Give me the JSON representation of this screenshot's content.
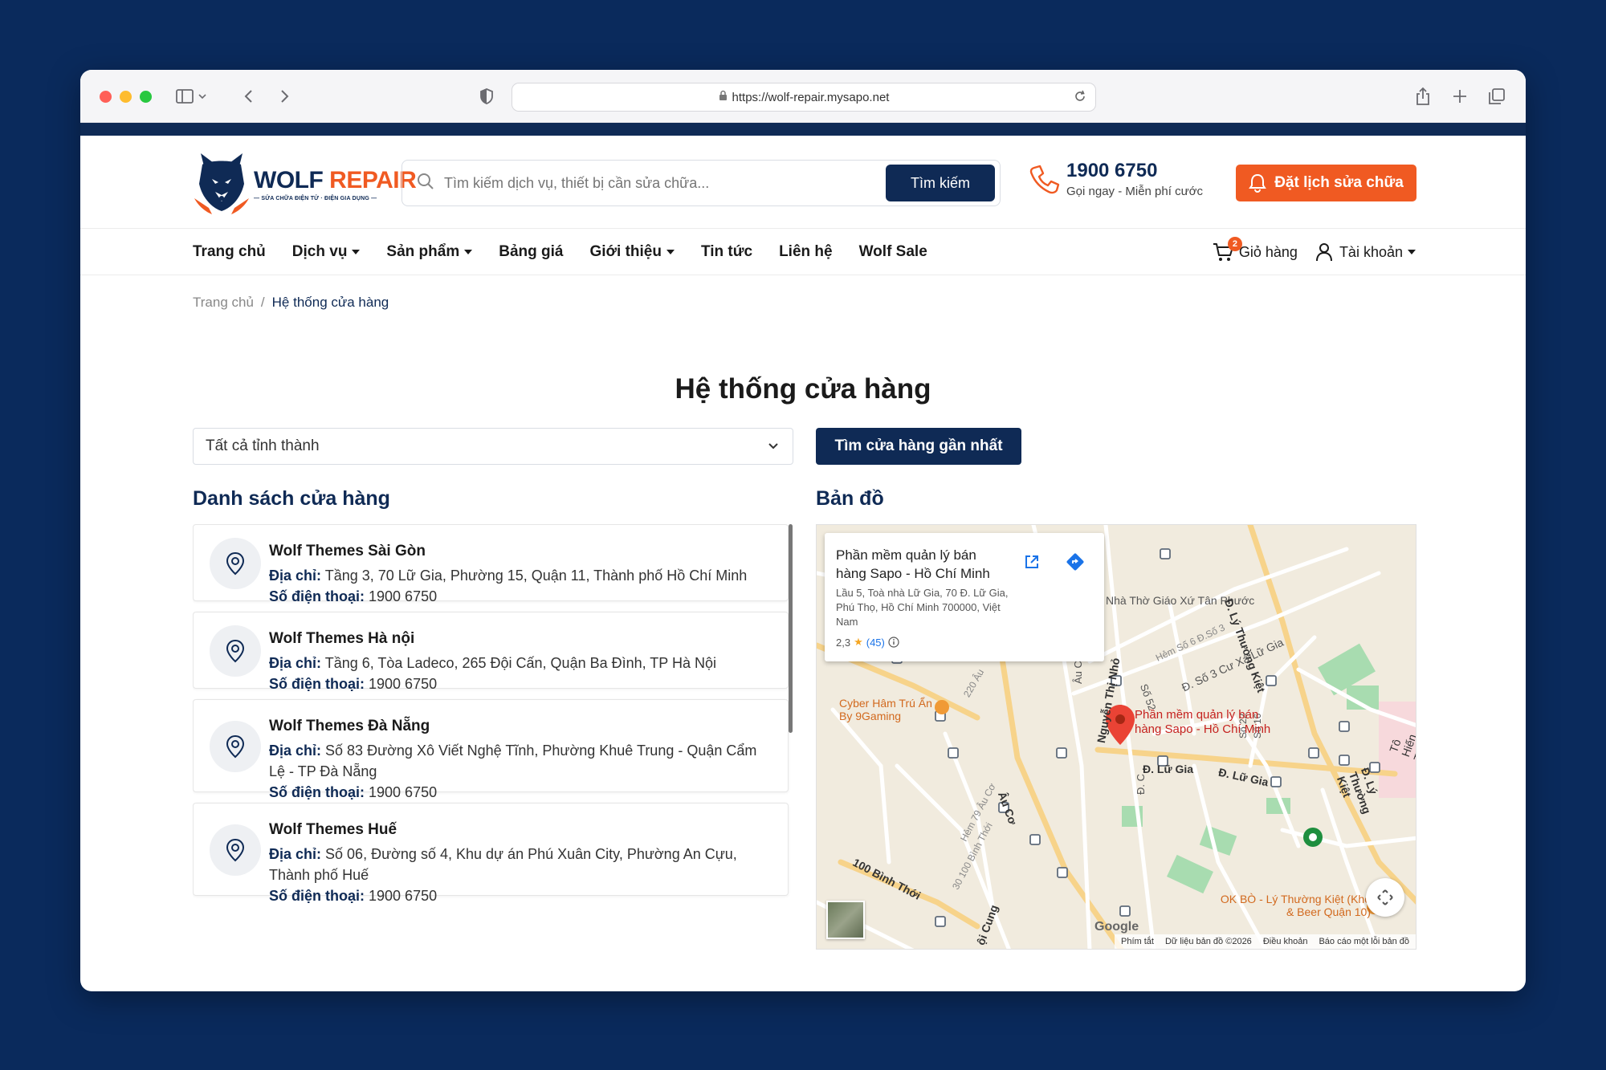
{
  "browser": {
    "url": "https://wolf-repair.mysapo.net"
  },
  "header": {
    "logo_title_a": "WOLF",
    "logo_title_b": "REPAIR",
    "logo_sub": "— SỬA CHỮA ĐIỆN TỬ · ĐIỆN GIA DỤNG —",
    "search_placeholder": "Tìm kiếm dịch vụ, thiết bị cần sửa chữa...",
    "search_button": "Tìm kiếm",
    "hotline_number": "1900 6750",
    "hotline_sub": "Gọi ngay - Miễn phí cước",
    "book_button": "Đặt lịch sửa chữa"
  },
  "nav": {
    "items": [
      {
        "label": "Trang chủ",
        "dropdown": false
      },
      {
        "label": "Dịch vụ",
        "dropdown": true
      },
      {
        "label": "Sản phẩm",
        "dropdown": true
      },
      {
        "label": "Bảng giá",
        "dropdown": false
      },
      {
        "label": "Giới thiệu",
        "dropdown": true
      },
      {
        "label": "Tin tức",
        "dropdown": false
      },
      {
        "label": "Liên hệ",
        "dropdown": false
      },
      {
        "label": "Wolf Sale",
        "dropdown": false
      }
    ],
    "cart_count": "2",
    "cart_label": "Giỏ hàng",
    "account_label": "Tài khoản"
  },
  "breadcrumb": {
    "home": "Trang chủ",
    "separator": "/",
    "current": "Hệ thống cửa hàng"
  },
  "page": {
    "title": "Hệ thống cửa hàng",
    "province_select": "Tất cả tỉnh thành",
    "nearest_button": "Tìm cửa hàng gần nhất",
    "list_title": "Danh sách cửa hàng",
    "map_title": "Bản đồ"
  },
  "stores": [
    {
      "name": "Wolf Themes Sài Gòn",
      "address_label": "Địa chỉ:",
      "address": "Tầng 3, 70 Lữ Gia, Phường 15, Quận 11, Thành phố Hồ Chí Minh",
      "phone_label": "Số điện thoại:",
      "phone": "1900 6750"
    },
    {
      "name": "Wolf Themes Hà nội",
      "address_label": "Địa chỉ:",
      "address": "Tầng 6, Tòa Ladeco, 265 Đội Cấn, Quận Ba Đình, TP Hà Nội",
      "phone_label": "Số điện thoại:",
      "phone": "1900 6750"
    },
    {
      "name": "Wolf Themes Đà Nẵng",
      "address_label": "Địa chỉ:",
      "address": "Số 83 Đường Xô Viết Nghệ Tĩnh, Phường Khuê Trung - Quận Cẩm Lệ - TP Đà Nẵng",
      "phone_label": "Số điện thoại:",
      "phone": "1900 6750"
    },
    {
      "name": "Wolf Themes Huế",
      "address_label": "Địa chỉ:",
      "address": "Số 06, Đường số 4, Khu dự án Phú Xuân City, Phường An Cựu, Thành phố Huế",
      "phone_label": "Số điện thoại:",
      "phone": "1900 6750"
    }
  ],
  "map": {
    "info_title": "Phần mềm quản lý bán hàng Sapo - Hồ Chí Minh",
    "info_address": "Lầu 5, Toà nhà Lữ Gia, 70 Đ. Lữ Gia, Phú Thọ, Hồ Chí Minh 700000, Việt Nam",
    "info_rating": "2,3",
    "info_reviews": "(45)",
    "pin_label": "Phần mềm quản lý bán hàng Sapo - Hồ Chí Minh",
    "labels": {
      "church": "Nhà Thờ Giáo Xứ Tân Phước",
      "cyber": "Cyber Hâm Trú Ẩn By 9Gaming",
      "okbo": "OK BÒ - Lý Thường Kiệt (Kho & Beer Quận 10)",
      "ly_thuong_kiet": "Đ. Lý Thường Kiệt",
      "ly_thuong_kiet_2": "Đ. Lý Thường Kiệt",
      "lu_gia": "Đ. Lữ Gia",
      "lu_gia_2": "Đ. Lữ Gia",
      "au_co": "Âu Cơ",
      "binh_thoi": "100 Bình Thới",
      "to_hien_thanh": "Tô Hiến Th",
      "nguyen_thi_nho": "Nguyễn Thị Nhỏ",
      "cu_xa": "Đ. Số 3 Cư Xá Lữ Gia",
      "hem_so_6": "Hẻm Số 6 Đ.Số 3",
      "hem_220": "220 Âu",
      "hem_79": "Hẻm 79 Âu Cơ",
      "hem_30": "30 100 Bình Thới",
      "doi_cung": "ội Cung",
      "so_52": "Số 52",
      "so_22": "Số 22",
      "so_16": "Số 16",
      "au_co_2": "Âu Cơ",
      "d_c": "Đ. C",
      "google": "Google"
    },
    "footer": [
      "Phím tắt",
      "Dữ liệu bản đồ ©2026",
      "Điều khoản",
      "Báo cáo một lỗi bản đồ"
    ]
  },
  "colors": {
    "navy": "#0f2a55",
    "orange": "#f05a22",
    "background": "#0a2a5c"
  }
}
